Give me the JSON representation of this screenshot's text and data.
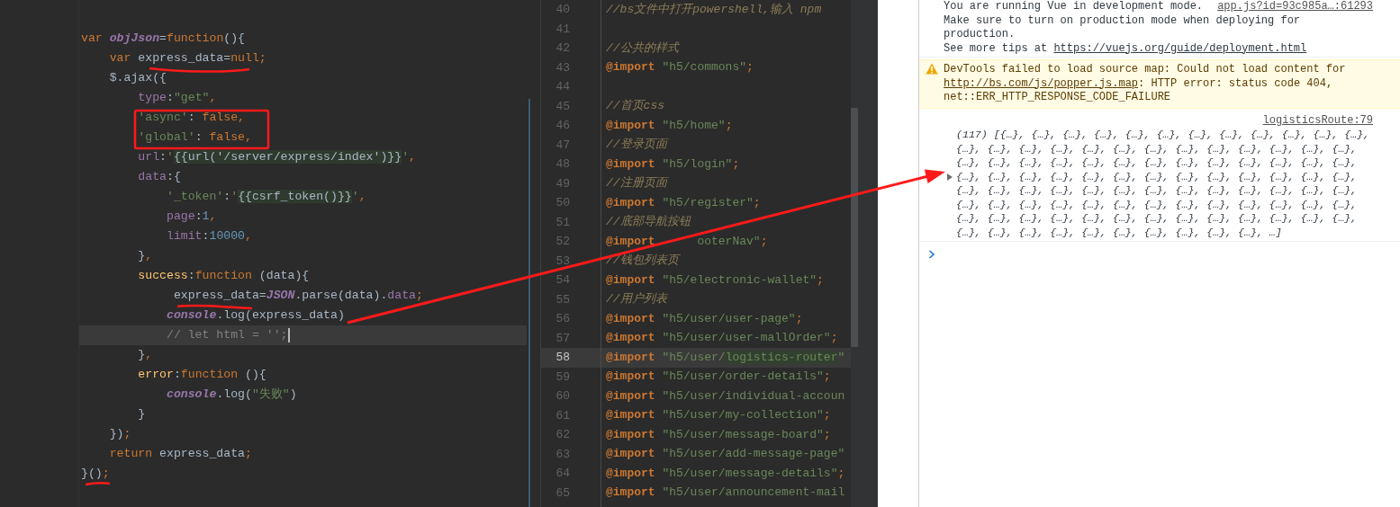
{
  "code_editor": {
    "lines": [
      {
        "current": false,
        "tokens": [
          {
            "kind": "kw",
            "text": "var"
          },
          {
            "kind": "glob",
            "text": " objJson"
          },
          {
            "kind": "def",
            "text": "="
          },
          {
            "kind": "kw",
            "text": "function"
          },
          {
            "kind": "def",
            "text": "(){"
          }
        ]
      },
      {
        "current": false,
        "tokens": [
          {
            "kind": "kw",
            "text": "    var"
          },
          {
            "kind": "def",
            "text": " express_data="
          },
          {
            "kind": "kw",
            "text": "null;"
          }
        ]
      },
      {
        "current": false,
        "tokens": [
          {
            "kind": "def",
            "text": "    $.ajax({"
          }
        ]
      },
      {
        "current": false,
        "tokens": [
          {
            "kind": "prop",
            "text": "        type"
          },
          {
            "kind": "def",
            "text": ":"
          },
          {
            "kind": "str",
            "text": "\"get\""
          },
          {
            "kind": "kw",
            "text": ","
          }
        ]
      },
      {
        "current": false,
        "tokens": [
          {
            "kind": "str",
            "text": "        'async'"
          },
          {
            "kind": "def",
            "text": ": "
          },
          {
            "kind": "kw",
            "text": "false,"
          }
        ]
      },
      {
        "current": false,
        "tokens": [
          {
            "kind": "str",
            "text": "        'global'"
          },
          {
            "kind": "def",
            "text": ": "
          },
          {
            "kind": "kw",
            "text": "false,"
          }
        ]
      },
      {
        "current": false,
        "tokens": [
          {
            "kind": "prop",
            "text": "        url"
          },
          {
            "kind": "def",
            "text": ":"
          },
          {
            "kind": "str",
            "text": "'"
          },
          {
            "kind": "tpl",
            "text": "{{url('/server/express/index')}}"
          },
          {
            "kind": "str",
            "text": "'"
          },
          {
            "kind": "kw",
            "text": ","
          }
        ]
      },
      {
        "current": false,
        "tokens": [
          {
            "kind": "prop",
            "text": "        data"
          },
          {
            "kind": "def",
            "text": ":{"
          }
        ]
      },
      {
        "current": false,
        "tokens": [
          {
            "kind": "str",
            "text": "            '_token'"
          },
          {
            "kind": "def",
            "text": ":"
          },
          {
            "kind": "str",
            "text": "'"
          },
          {
            "kind": "tpl",
            "text": "{{csrf_token()}}"
          },
          {
            "kind": "str",
            "text": "'"
          },
          {
            "kind": "kw",
            "text": ","
          }
        ]
      },
      {
        "current": false,
        "tokens": [
          {
            "kind": "prop",
            "text": "            page"
          },
          {
            "kind": "def",
            "text": ":"
          },
          {
            "kind": "num",
            "text": "1"
          },
          {
            "kind": "kw",
            "text": ","
          }
        ]
      },
      {
        "current": false,
        "tokens": [
          {
            "kind": "prop",
            "text": "            limit"
          },
          {
            "kind": "def",
            "text": ":"
          },
          {
            "kind": "num",
            "text": "10000"
          },
          {
            "kind": "kw",
            "text": ","
          }
        ]
      },
      {
        "current": false,
        "tokens": [
          {
            "kind": "def",
            "text": "        }"
          },
          {
            "kind": "kw",
            "text": ","
          }
        ]
      },
      {
        "current": false,
        "tokens": [
          {
            "kind": "fn",
            "text": "        success"
          },
          {
            "kind": "def",
            "text": ":"
          },
          {
            "kind": "kw",
            "text": "function"
          },
          {
            "kind": "def",
            "text": " (data){"
          }
        ]
      },
      {
        "current": false,
        "tokens": [
          {
            "kind": "def",
            "text": "             express_data="
          },
          {
            "kind": "glob",
            "text": "JSON"
          },
          {
            "kind": "def",
            "text": ".parse(data)."
          },
          {
            "kind": "prop",
            "text": "data"
          },
          {
            "kind": "kw",
            "text": ";"
          }
        ]
      },
      {
        "current": false,
        "tokens": [
          {
            "kind": "glob",
            "text": "            console"
          },
          {
            "kind": "def",
            "text": ".log(express_data)"
          }
        ]
      },
      {
        "current": true,
        "tokens": [
          {
            "kind": "comment",
            "text": "            // let html = '';"
          }
        ]
      },
      {
        "current": false,
        "tokens": [
          {
            "kind": "def",
            "text": "        }"
          },
          {
            "kind": "kw",
            "text": ","
          }
        ]
      },
      {
        "current": false,
        "tokens": [
          {
            "kind": "fn",
            "text": "        error"
          },
          {
            "kind": "def",
            "text": ":"
          },
          {
            "kind": "kw",
            "text": "function"
          },
          {
            "kind": "def",
            "text": " (){"
          }
        ]
      },
      {
        "current": false,
        "tokens": [
          {
            "kind": "glob",
            "text": "            console"
          },
          {
            "kind": "def",
            "text": ".log("
          },
          {
            "kind": "str",
            "text": "\"失败\""
          },
          {
            "kind": "def",
            "text": ")"
          }
        ]
      },
      {
        "current": false,
        "tokens": [
          {
            "kind": "def",
            "text": "        }"
          }
        ]
      },
      {
        "current": false,
        "tokens": [
          {
            "kind": "def",
            "text": "    })"
          },
          {
            "kind": "kw",
            "text": ";"
          }
        ]
      },
      {
        "current": false,
        "tokens": [
          {
            "kind": "kw",
            "text": "    return"
          },
          {
            "kind": "def",
            "text": " express_data"
          },
          {
            "kind": "kw",
            "text": ";"
          }
        ]
      },
      {
        "current": false,
        "tokens": [
          {
            "kind": "def",
            "text": "}()"
          },
          {
            "kind": "kw",
            "text": ";"
          }
        ]
      }
    ]
  },
  "stylesheet_editor": {
    "lines": [
      {
        "number": "40",
        "current": false,
        "tokens": [
          {
            "kind": "comment",
            "text": "//bs文件中打开powershell,输入 npm"
          }
        ]
      },
      {
        "number": "41",
        "current": false
      },
      {
        "number": "42",
        "current": false,
        "tokens": [
          {
            "kind": "comment",
            "text": "//公共的样式"
          }
        ]
      },
      {
        "number": "43",
        "current": false,
        "tokens": [
          {
            "kind": "at",
            "text": "@import"
          },
          {
            "kind": "str",
            "text": " \"h5/commons\""
          },
          {
            "kind": "kw",
            "text": ";"
          }
        ]
      },
      {
        "number": "44",
        "current": false
      },
      {
        "number": "45",
        "current": false,
        "tokens": [
          {
            "kind": "comment",
            "text": "//首页css"
          }
        ]
      },
      {
        "number": "46",
        "current": false,
        "tokens": [
          {
            "kind": "at",
            "text": "@import"
          },
          {
            "kind": "str",
            "text": " \"h5/home\""
          },
          {
            "kind": "kw",
            "text": ";"
          }
        ]
      },
      {
        "number": "47",
        "current": false,
        "tokens": [
          {
            "kind": "comment",
            "text": "//登录页面"
          }
        ]
      },
      {
        "number": "48",
        "current": false,
        "tokens": [
          {
            "kind": "at",
            "text": "@import"
          },
          {
            "kind": "str",
            "text": " \"h5/login\""
          },
          {
            "kind": "kw",
            "text": ";"
          }
        ]
      },
      {
        "number": "49",
        "current": false,
        "tokens": [
          {
            "kind": "comment",
            "text": "//注册页面"
          }
        ]
      },
      {
        "number": "50",
        "current": false,
        "tokens": [
          {
            "kind": "at",
            "text": "@import"
          },
          {
            "kind": "str",
            "text": " \"h5/register\""
          },
          {
            "kind": "kw",
            "text": ";"
          }
        ]
      },
      {
        "number": "51",
        "current": false,
        "tokens": [
          {
            "kind": "comment",
            "text": "//底部导航按钮"
          }
        ]
      },
      {
        "number": "52",
        "current": false,
        "tokens": [
          {
            "kind": "at",
            "text": "@import"
          },
          {
            "kind": "cover"
          },
          {
            "kind": "str",
            "text": "ooterNav\""
          },
          {
            "kind": "kw",
            "text": ";"
          }
        ]
      },
      {
        "number": "53",
        "current": false,
        "tokens": [
          {
            "kind": "comment",
            "text": "//钱包列表页"
          }
        ]
      },
      {
        "number": "54",
        "current": false,
        "tokens": [
          {
            "kind": "at",
            "text": "@import"
          },
          {
            "kind": "str",
            "text": " \"h5/electronic-wallet\""
          },
          {
            "kind": "kw",
            "text": ";"
          }
        ]
      },
      {
        "number": "55",
        "current": false,
        "tokens": [
          {
            "kind": "comment",
            "text": "//用户列表"
          }
        ]
      },
      {
        "number": "56",
        "current": false,
        "tokens": [
          {
            "kind": "at",
            "text": "@import"
          },
          {
            "kind": "str",
            "text": " \"h5/user/user-page\""
          },
          {
            "kind": "kw",
            "text": ";"
          }
        ]
      },
      {
        "number": "57",
        "current": false,
        "tokens": [
          {
            "kind": "at",
            "text": "@import"
          },
          {
            "kind": "str",
            "text": " \"h5/user/user-mallOrder\""
          },
          {
            "kind": "kw",
            "text": ";"
          }
        ]
      },
      {
        "number": "58",
        "current": true,
        "tokens": [
          {
            "kind": "at",
            "text": "@import"
          },
          {
            "kind": "str",
            "text": " \"h5/user/"
          },
          {
            "kind": "match",
            "text": "logistics-router"
          },
          {
            "kind": "str",
            "text": "\""
          }
        ]
      },
      {
        "number": "59",
        "current": false,
        "tokens": [
          {
            "kind": "at",
            "text": "@import"
          },
          {
            "kind": "str",
            "text": " \"h5/user/order-details\""
          },
          {
            "kind": "kw",
            "text": ";"
          }
        ]
      },
      {
        "number": "60",
        "current": false,
        "tokens": [
          {
            "kind": "at",
            "text": "@import"
          },
          {
            "kind": "str",
            "text": " \"h5/user/individual-accoun"
          }
        ]
      },
      {
        "number": "61",
        "current": false,
        "tokens": [
          {
            "kind": "at",
            "text": "@import"
          },
          {
            "kind": "str",
            "text": " \"h5/user/my-collection\""
          },
          {
            "kind": "kw",
            "text": ";"
          }
        ]
      },
      {
        "number": "62",
        "current": false,
        "tokens": [
          {
            "kind": "at",
            "text": "@import"
          },
          {
            "kind": "str",
            "text": " \"h5/user/message-board\""
          },
          {
            "kind": "kw",
            "text": ";"
          }
        ]
      },
      {
        "number": "63",
        "current": false,
        "tokens": [
          {
            "kind": "at",
            "text": "@import"
          },
          {
            "kind": "str",
            "text": " \"h5/user/add-message-page\""
          }
        ]
      },
      {
        "number": "64",
        "current": false,
        "tokens": [
          {
            "kind": "at",
            "text": "@import"
          },
          {
            "kind": "str",
            "text": " \"h5/user/message-details\""
          },
          {
            "kind": "kw",
            "text": ";"
          }
        ]
      },
      {
        "number": "65",
        "current": false,
        "tokens": [
          {
            "kind": "at",
            "text": "@import"
          },
          {
            "kind": "str",
            "text": " \"h5/user/announcement-mail"
          }
        ]
      }
    ]
  },
  "console": {
    "messages": [
      {
        "kind": "info",
        "title": "You are running Vue in development mode.",
        "source": "app.js?id=93c985a…:61293",
        "text": "Make sure to turn on production mode when deploying for production.\nSee more tips at ",
        "link": "https://vuejs.org/guide/deployment.html"
      },
      {
        "kind": "warning",
        "text": "DevTools failed to load source map: Could not load content for ",
        "link": "http://bs.com/js/popper.js.map",
        "text_after": ": HTTP error: status code 404, net::ERR_HTTP_RESPONSE_CODE_FAILURE"
      },
      {
        "kind": "log",
        "source": "logisticsRoute:79",
        "expanded": false,
        "text": "(117) [{…}, {…}, {…}, {…}, {…}, {…}, {…}, {…}, {…}, {…}, {…}, {…}, {…}, {…}, {…}, {…}, {…}, {…}, {…}, {…}, {…}, {…}, {…}, {…}, {…}, {…}, {…}, {…}, {…}, {…}, {…}, {…}, {…}, {…}, {…}, {…}, {…}, {…}, {…}, {…}, {…}, {…}, {…}, {…}, {…}, {…}, {…}, {…}, {…}, {…}, {…}, {…}, {…}, {…}, {…}, {…}, {…}, {…}, {…}, {…}, {…}, {…}, {…}, {…}, {…}, {…}, {…}, {…}, {…}, {…}, {…}, {…}, {…}, {…}, {…}, {…}, {…}, {…}, {…}, {…}, {…}, {…}, {…}, {…}, {…}, {…}, {…}, {…}, {…}, {…}, {…}, {…}, {…}, {…}, {…}, {…}, {…}, {…}, {…}, {…}, …]"
      }
    ]
  },
  "annotations": [
    {
      "kind": "underline"
    },
    {
      "kind": "frame"
    },
    {
      "kind": "underline"
    },
    {
      "kind": "underline"
    },
    {
      "kind": "arrow"
    }
  ]
}
